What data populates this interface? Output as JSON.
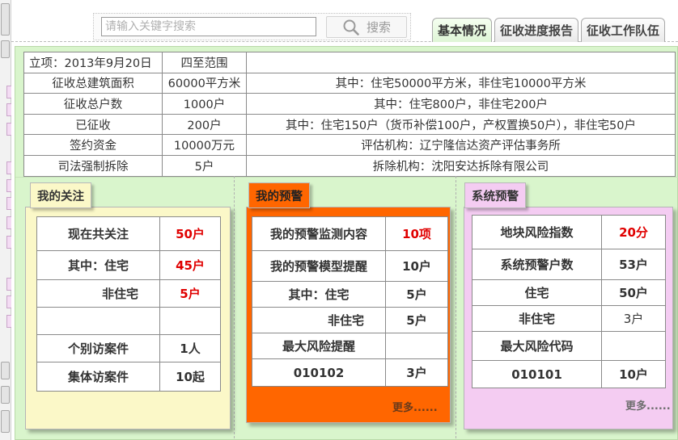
{
  "search": {
    "placeholder": "请输入关键字搜索",
    "button_label": "搜索",
    "icon": "search-icon"
  },
  "tabs": [
    {
      "label": "基本情况",
      "active": true
    },
    {
      "label": "征收进度报告",
      "active": false
    },
    {
      "label": "征收工作队伍",
      "active": false
    }
  ],
  "info": {
    "rows": [
      [
        "立项：2013年9月20日",
        "四至范围",
        ""
      ],
      [
        "征收总建筑面积",
        "60000平方米",
        "其中：住宅50000平方米，非住宅10000平方米"
      ],
      [
        "征收总户数",
        "1000户",
        "其中：住宅800户，非住宅200户"
      ],
      [
        "已征收",
        "200户",
        "其中：住宅150户（货币补偿100户，产权置换50户），非住宅50户"
      ],
      [
        "签约资金",
        "10000万元",
        "评估机构：辽宁隆信达资产评估事务所"
      ],
      [
        "司法强制拆除",
        "5户",
        "拆除机构：沈阳安达拆除有限公司"
      ]
    ]
  },
  "my_focus": {
    "title": "我的关注",
    "rows": [
      [
        "现在共关注",
        "50户"
      ],
      [
        "其中：住宅",
        "45户"
      ],
      [
        "非住宅",
        "5户"
      ],
      [
        "",
        ""
      ],
      [
        "个别访案件",
        "1人"
      ],
      [
        "集体访案件",
        "10起"
      ]
    ]
  },
  "my_alert": {
    "title": "我的预警",
    "rows": [
      [
        "我的预警监测内容",
        "10项"
      ],
      [
        "我的预警模型提醒",
        "10户"
      ],
      [
        "其中：住宅",
        "5户"
      ],
      [
        "非住宅",
        "5户"
      ],
      [
        "最大风险提醒",
        ""
      ],
      [
        "010102",
        "3户"
      ]
    ],
    "more": "更多......"
  },
  "system_alert": {
    "title": "系统预警",
    "rows": [
      [
        "地块风险指数",
        "20分"
      ],
      [
        "系统预警户数",
        "53户"
      ],
      [
        "住宅",
        "50户"
      ],
      [
        "非住宅",
        "3户"
      ],
      [
        "最大风险代码",
        ""
      ],
      [
        "010101",
        "10户"
      ]
    ],
    "more": "更多......"
  },
  "colors": {
    "main_bg": "#d9f5cc",
    "focus_panel": "#fbf8c8",
    "alert_panel": "#ff6600",
    "system_panel": "#f4ccf2",
    "highlight_red": "#e00000"
  }
}
